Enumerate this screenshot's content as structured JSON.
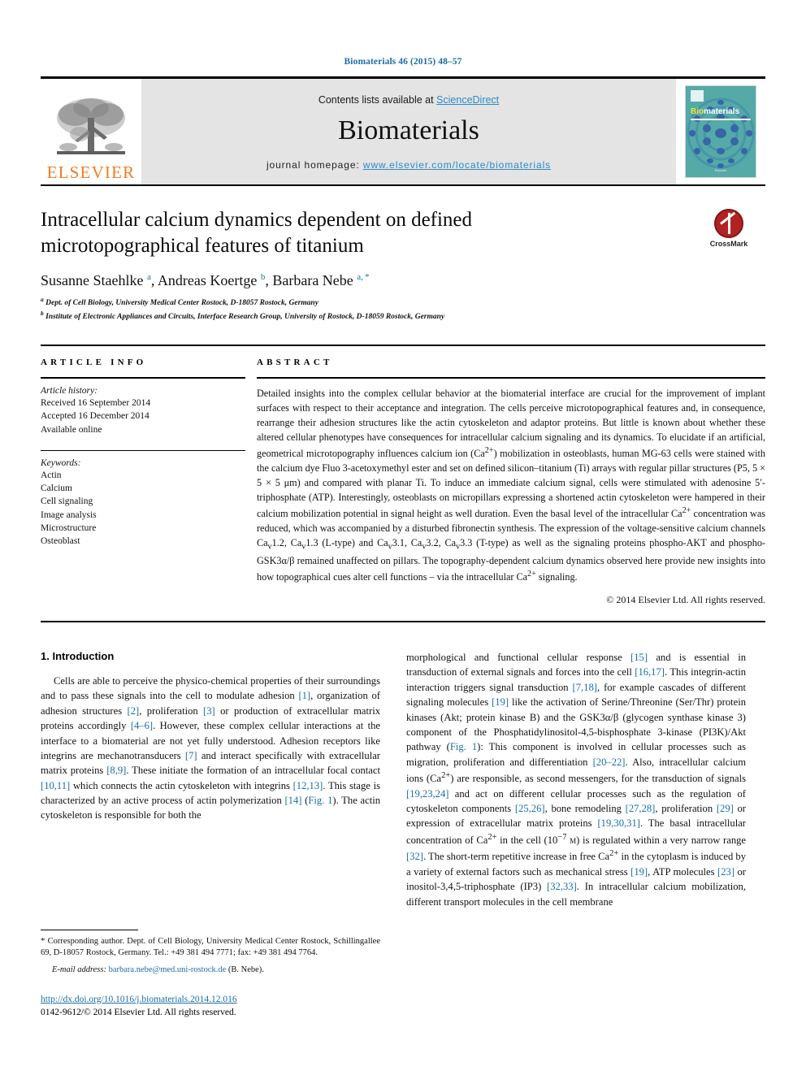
{
  "running_head": "Biomaterials 46 (2015) 48–57",
  "masthead": {
    "contents_prefix": "Contents lists available at ",
    "sciencedirect": "ScienceDirect",
    "journal_name": "Biomaterials",
    "homepage_prefix": "journal homepage: ",
    "homepage_url": "www.elsevier.com/locate/biomaterials",
    "publisher_logo_text": "ELSEVIER",
    "cover": {
      "title_bold": "Bio",
      "title_rest": "materials",
      "footer": "Elsevier"
    }
  },
  "crossmark": {
    "label": "CrossMark"
  },
  "article": {
    "title": "Intracellular calcium dynamics dependent on defined microtopographical features of titanium",
    "authors_html": "Susanne Staehlke <sup>a</sup>, Andreas Koertge <sup>b</sup>, Barbara Nebe <sup>a, *</sup>",
    "affiliations": [
      "a Dept. of Cell Biology, University Medical Center Rostock, D-18057 Rostock, Germany",
      "b Institute of Electronic Appliances and Circuits, Interface Research Group, University of Rostock, D-18059 Rostock, Germany"
    ]
  },
  "article_info": {
    "heading": "ARTICLE INFO",
    "history_label": "Article history:",
    "history": [
      "Received 16 September 2014",
      "Accepted 16 December 2014",
      "Available online"
    ],
    "keywords_label": "Keywords:",
    "keywords": [
      "Actin",
      "Calcium",
      "Cell signaling",
      "Image analysis",
      "Microstructure",
      "Osteoblast"
    ]
  },
  "abstract": {
    "heading": "ABSTRACT",
    "text_html": "Detailed insights into the complex cellular behavior at the biomaterial interface are crucial for the improvement of implant surfaces with respect to their acceptance and integration. The cells perceive microtopographical features and, in consequence, rearrange their adhesion structures like the actin cytoskeleton and adaptor proteins. But little is known about whether these altered cellular phenotypes have consequences for intracellular calcium signaling and its dynamics. To elucidate if an artificial, geometrical microtopography influences calcium ion (Ca<sup>2+</sup>) mobilization in osteoblasts, human MG-63 cells were stained with the calcium dye Fluo 3-acetoxymethyl ester and set on defined silicon–titanium (Ti) arrays with regular pillar structures (P5, 5 × 5 × 5 μm) and compared with planar Ti. To induce an immediate calcium signal, cells were stimulated with adenosine 5′-triphosphate (ATP). Interestingly, osteoblasts on micropillars expressing a shortened actin cytoskeleton were hampered in their calcium mobilization potential in signal height as well duration. Even the basal level of the intracellular Ca<sup>2+</sup> concentration was reduced, which was accompanied by a disturbed fibronectin synthesis. The expression of the voltage-sensitive calcium channels Ca<sub>v</sub>1.2, Ca<sub>v</sub>1.3 (L-type) and Ca<sub>v</sub>3.1, Ca<sub>v</sub>3.2, Ca<sub>v</sub>3.3 (T-type) as well as the signaling proteins phospho-AKT and phospho-GSK3α/β remained unaffected on pillars. The topography-dependent calcium dynamics observed here provide new insights into how topographical cues alter cell functions – via the intracellular Ca<sup>2+</sup> signaling.",
    "copyright": "© 2014 Elsevier Ltd. All rights reserved."
  },
  "introduction": {
    "number_title": "1. Introduction",
    "left_paragraph_html": "Cells are able to perceive the physico-chemical properties of their surroundings and to pass these signals into the cell to modulate adhesion <span class=\"ref\">[1]</span>, organization of adhesion structures <span class=\"ref\">[2]</span>, proliferation <span class=\"ref\">[3]</span> or production of extracellular matrix proteins accordingly <span class=\"ref\">[4–6]</span>. However, these complex cellular interactions at the interface to a biomaterial are not yet fully understood. Adhesion receptors like integrins are mechanotransducers <span class=\"ref\">[7]</span> and interact specifically with extracellular matrix proteins <span class=\"ref\">[8,9]</span>. These initiate the formation of an intracellular focal contact <span class=\"ref\">[10,11]</span> which connects the actin cytoskeleton with integrins <span class=\"ref\">[12,13]</span>. This stage is characterized by an active process of actin polymerization <span class=\"ref\">[14]</span> (<span class=\"ref\">Fig. 1</span>). The actin cytoskeleton is responsible for both the",
    "right_paragraph_html": "morphological and functional cellular response <span class=\"ref\">[15]</span> and is essential in transduction of external signals and forces into the cell <span class=\"ref\">[16,17]</span>. This integrin-actin interaction triggers signal transduction <span class=\"ref\">[7,18]</span>, for example cascades of different signaling molecules <span class=\"ref\">[19]</span> like the activation of Serine/Threonine (Ser/Thr) protein kinases (Akt; protein kinase B) and the GSK3α/β (glycogen synthase kinase 3) component of the Phosphatidylinositol-4,5-bisphosphate 3-kinase (PI3K)/Akt pathway (<span class=\"ref\">Fig. 1</span>): This component is involved in cellular processes such as migration, proliferation and differentiation <span class=\"ref\">[20–22]</span>. Also, intracellular calcium ions (Ca<sup>2+</sup>) are responsible, as second messengers, for the transduction of signals <span class=\"ref\">[19,23,24]</span> and act on different cellular processes such as the regulation of cytoskeleton components <span class=\"ref\">[25,26]</span>, bone remodeling <span class=\"ref\">[27,28]</span>, proliferation <span class=\"ref\">[29]</span> or expression of extracellular matrix proteins <span class=\"ref\">[19,30,31]</span>. The basal intracellular concentration of Ca<sup>2+</sup> in the cell (10<sup>−7</sup> <span style=\"font-variant:small-caps\">m</span>) is regulated within a very narrow range <span class=\"ref\">[32]</span>. The short-term repetitive increase in free Ca<sup>2+</sup> in the cytoplasm is induced by a variety of external factors such as mechanical stress <span class=\"ref\">[19]</span>, ATP molecules <span class=\"ref\">[23]</span> or inositol-3,4,5-triphosphate (IP3) <span class=\"ref\">[32,33]</span>. In intracellular calcium mobilization, different transport molecules in the cell membrane"
  },
  "footnote": {
    "corresponding_html": "<span class=\"star\">*</span> Corresponding author. Dept. of Cell Biology, University Medical Center Rostock, Schillingallee 69, D-18057 Rostock, Germany. Tel.: +49 381 494 7771; fax: +49 381 494 7764.",
    "email_label": "E-mail address:",
    "email": "barbara.nebe@med.uni-rostock.de",
    "email_suffix": "(B. Nebe)."
  },
  "doi_block": {
    "doi_url": "http://dx.doi.org/10.1016/j.biomaterials.2014.12.016",
    "issn_line": "0142-9612/© 2014 Elsevier Ltd. All rights reserved."
  },
  "colors": {
    "link_blue": "#1a6ea8",
    "sciencedirect_blue": "#2c8bc4",
    "elsevier_orange": "#ef7c22",
    "masthead_grey": "#e4e4e4",
    "cover_teal": "#54a9a8",
    "crossmark_red": "#b32222"
  }
}
